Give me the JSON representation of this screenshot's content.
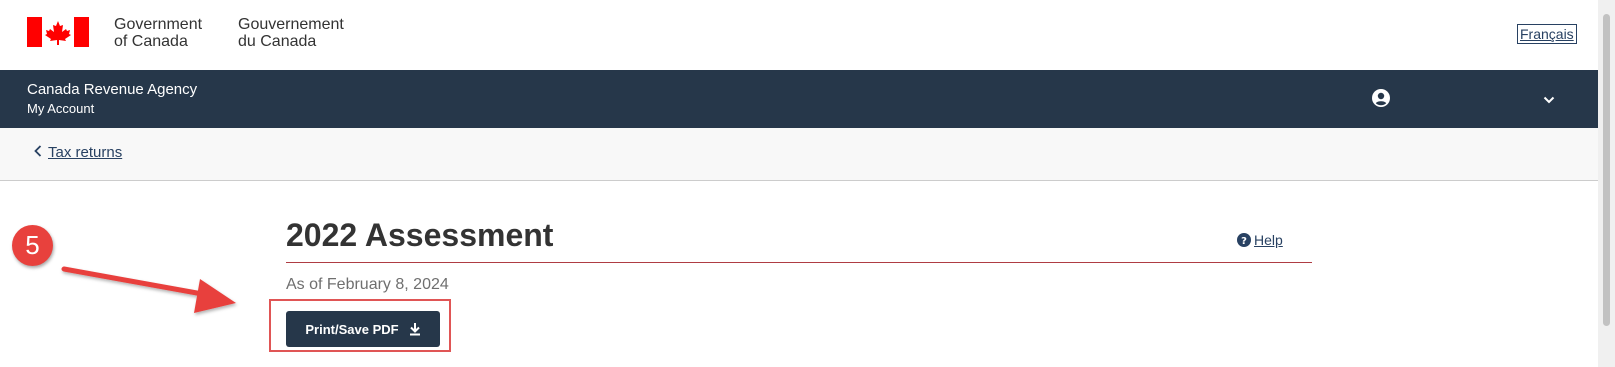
{
  "header": {
    "gov_en_line1": "Government",
    "gov_en_line2": "of Canada",
    "gov_fr_line1": "Gouvernement",
    "gov_fr_line2": "du Canada",
    "language_link": "Français",
    "flag_icon": "canada-flag-icon"
  },
  "nav": {
    "agency": "Canada Revenue Agency",
    "account": "My Account",
    "user_icon": "user-circle-icon",
    "menu_icon": "chevron-down-icon"
  },
  "breadcrumb": {
    "icon": "chevron-left-icon",
    "label": "Tax returns"
  },
  "annotation": {
    "step_number": "5",
    "color": "#e8413d"
  },
  "main": {
    "title": "2022 Assessment",
    "help_label": "Help",
    "help_icon": "question-circle-icon",
    "as_of": "As of February 8, 2024",
    "print_button_label": "Print/Save PDF",
    "print_button_icon": "download-icon"
  },
  "colors": {
    "navbar": "#26374a",
    "link": "#284162",
    "title_rule": "#af3c43",
    "flag_red": "#ff0000"
  }
}
